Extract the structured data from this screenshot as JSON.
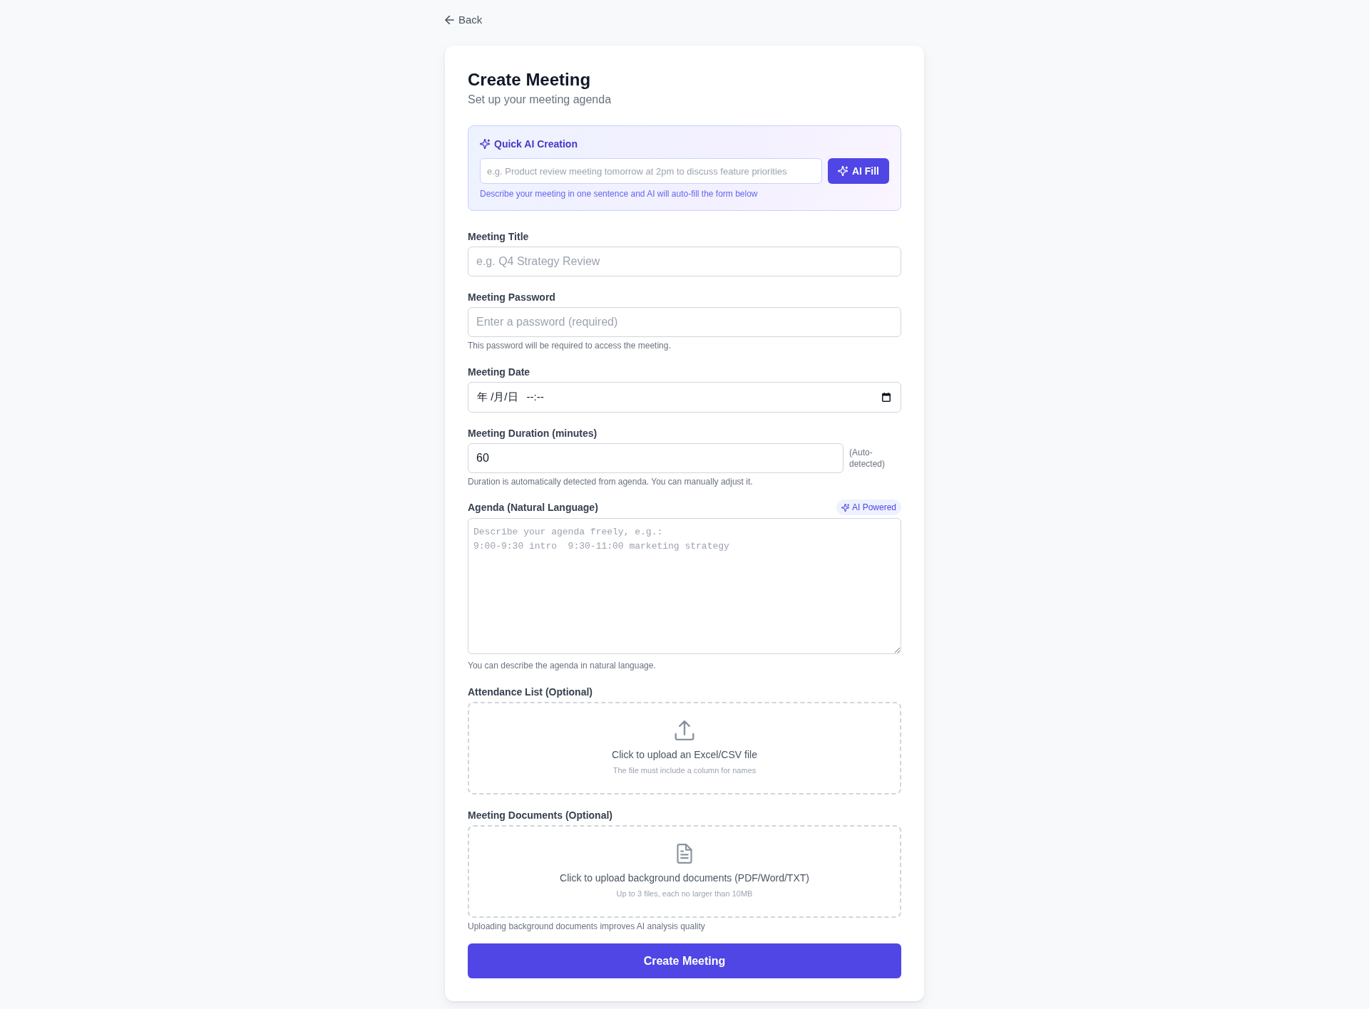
{
  "back_link": {
    "label": "Back"
  },
  "header": {
    "title": "Create Meeting",
    "subtitle": "Set up your meeting agenda"
  },
  "quick_ai": {
    "title": "Quick AI Creation",
    "prompt": {
      "placeholder": "e.g. Product review meeting tomorrow at 2pm to discuss feature priorities"
    },
    "button": "AI Fill",
    "hint": "Describe your meeting in one sentence and AI will auto-fill the form below"
  },
  "fields": [
    {
      "kind": "text",
      "label": "Meeting Title",
      "placeholder": "e.g. Q4 Strategy Review"
    },
    {
      "kind": "password",
      "label": "Meeting Password",
      "placeholder": "Enter a password (required)",
      "hint": "This password will be required to access the meeting."
    },
    {
      "kind": "datetime",
      "label": "Meeting Date",
      "date_placeholder": "年 /月/日",
      "time_placeholder": "--:--"
    },
    {
      "kind": "number",
      "label": "Meeting Duration (minutes)",
      "value": "60",
      "note": "(Auto-detected)",
      "hint": "Duration is automatically detected from agenda. You can manually adjust it."
    },
    {
      "kind": "textarea",
      "label": "Agenda (Natural Language)",
      "badge": "AI Powered",
      "placeholder": "Describe your agenda freely, e.g.:\n9:00-9:30 intro  9:30-11:00 marketing strategy",
      "hint": "You can describe the agenda in natural language."
    },
    {
      "kind": "sheet_upload",
      "label": "Attendance List (Optional)",
      "prompt": "Click to upload an Excel/CSV file",
      "note": "The file must include a column for names"
    },
    {
      "kind": "document_upload",
      "label": "Meeting Documents (Optional)",
      "prompt": "Click to upload background documents (PDF/Word/TXT)",
      "note": "Up to 3 files, each no larger than 10MB",
      "hint": "Uploading background documents improves AI analysis quality"
    }
  ],
  "submit_button": "Create Meeting"
}
